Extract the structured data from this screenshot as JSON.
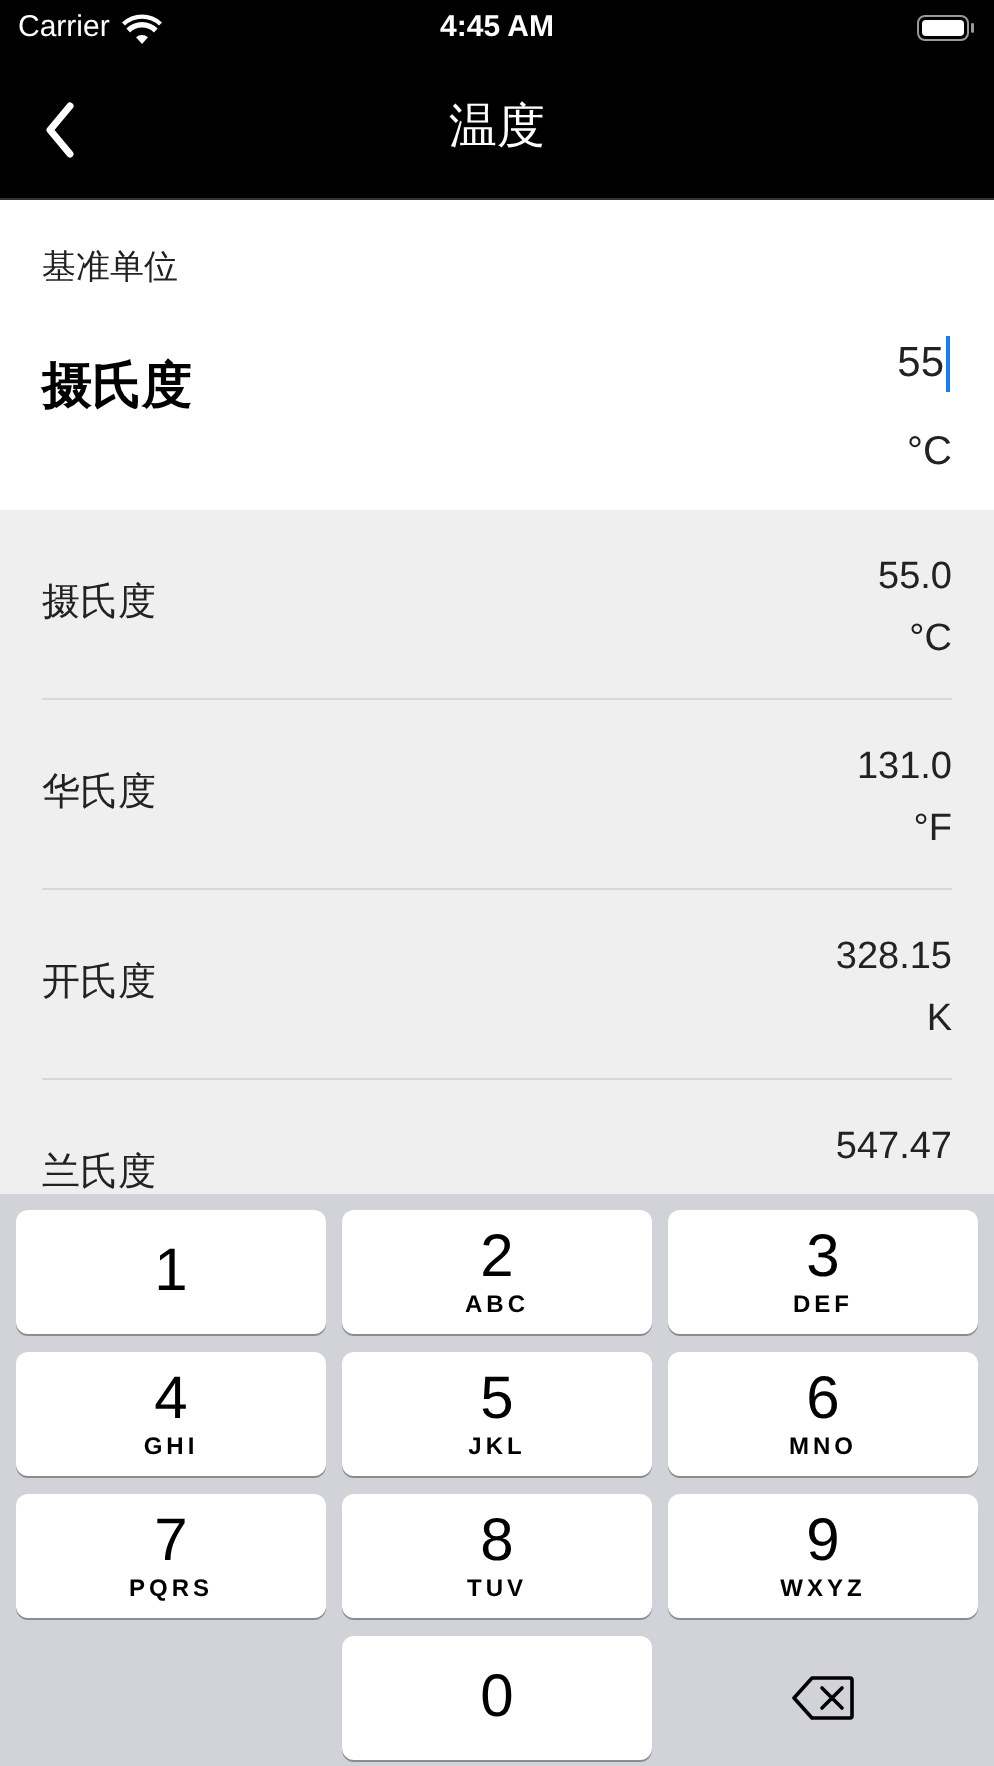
{
  "status_bar": {
    "carrier": "Carrier",
    "time": "4:45 AM"
  },
  "nav": {
    "title": "温度"
  },
  "base": {
    "label": "基准单位",
    "unit_name": "摄氏度",
    "value": "55",
    "unit": "°C"
  },
  "results": [
    {
      "name": "摄氏度",
      "value": "55.0",
      "unit": "°C"
    },
    {
      "name": "华氏度",
      "value": "131.0",
      "unit": "°F"
    },
    {
      "name": "开氏度",
      "value": "328.15",
      "unit": "K"
    },
    {
      "name": "兰氏度",
      "value": "547.47"
    }
  ],
  "keyboard": [
    {
      "kind": "digit",
      "digit": "1"
    },
    {
      "kind": "digit",
      "digit": "2",
      "letters": "ABC"
    },
    {
      "kind": "digit",
      "digit": "3",
      "letters": "DEF"
    },
    {
      "kind": "digit",
      "digit": "4",
      "letters": "GHI"
    },
    {
      "kind": "digit",
      "digit": "5",
      "letters": "JKL"
    },
    {
      "kind": "digit",
      "digit": "6",
      "letters": "MNO"
    },
    {
      "kind": "digit",
      "digit": "7",
      "letters": "PQRS"
    },
    {
      "kind": "digit",
      "digit": "8",
      "letters": "TUV"
    },
    {
      "kind": "digit",
      "digit": "9",
      "letters": "WXYZ"
    },
    {
      "kind": "blank"
    },
    {
      "kind": "digit",
      "digit": "0"
    },
    {
      "kind": "delete"
    }
  ]
}
